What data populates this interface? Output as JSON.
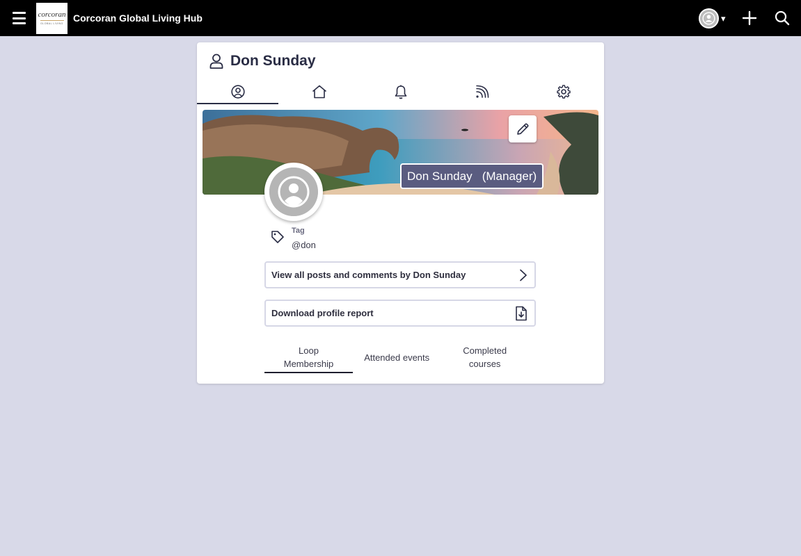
{
  "header": {
    "logo_text": "corcoran",
    "logo_subtext": "GLOBAL LIVING",
    "app_title": "Corcoran Global Living Hub",
    "menu_icon": "hamburger-icon",
    "profile_caret": "▾",
    "add_icon": "plus-icon",
    "search_icon": "search-icon"
  },
  "profile": {
    "title": "Don Sunday",
    "tabs": [
      {
        "icon": "user-circle-icon",
        "active": true
      },
      {
        "icon": "home-icon",
        "active": false
      },
      {
        "icon": "bell-icon",
        "active": false
      },
      {
        "icon": "rss-feed-icon",
        "active": false
      },
      {
        "icon": "gear-icon",
        "active": false
      }
    ],
    "banner_name": "Don Sunday   (Manager)",
    "tag_label": "Tag",
    "tag_value": "@don",
    "posts_button": "View all posts and comments by Don Sunday",
    "report_button": "Download profile report",
    "subtabs": {
      "membership": "Loop Membership",
      "events": "Attended events",
      "courses": "Completed courses"
    }
  },
  "colors": {
    "topbar": "#000000",
    "background": "#d8d9e8",
    "accent": "#2a2d45",
    "badge": "#5a5c80"
  }
}
